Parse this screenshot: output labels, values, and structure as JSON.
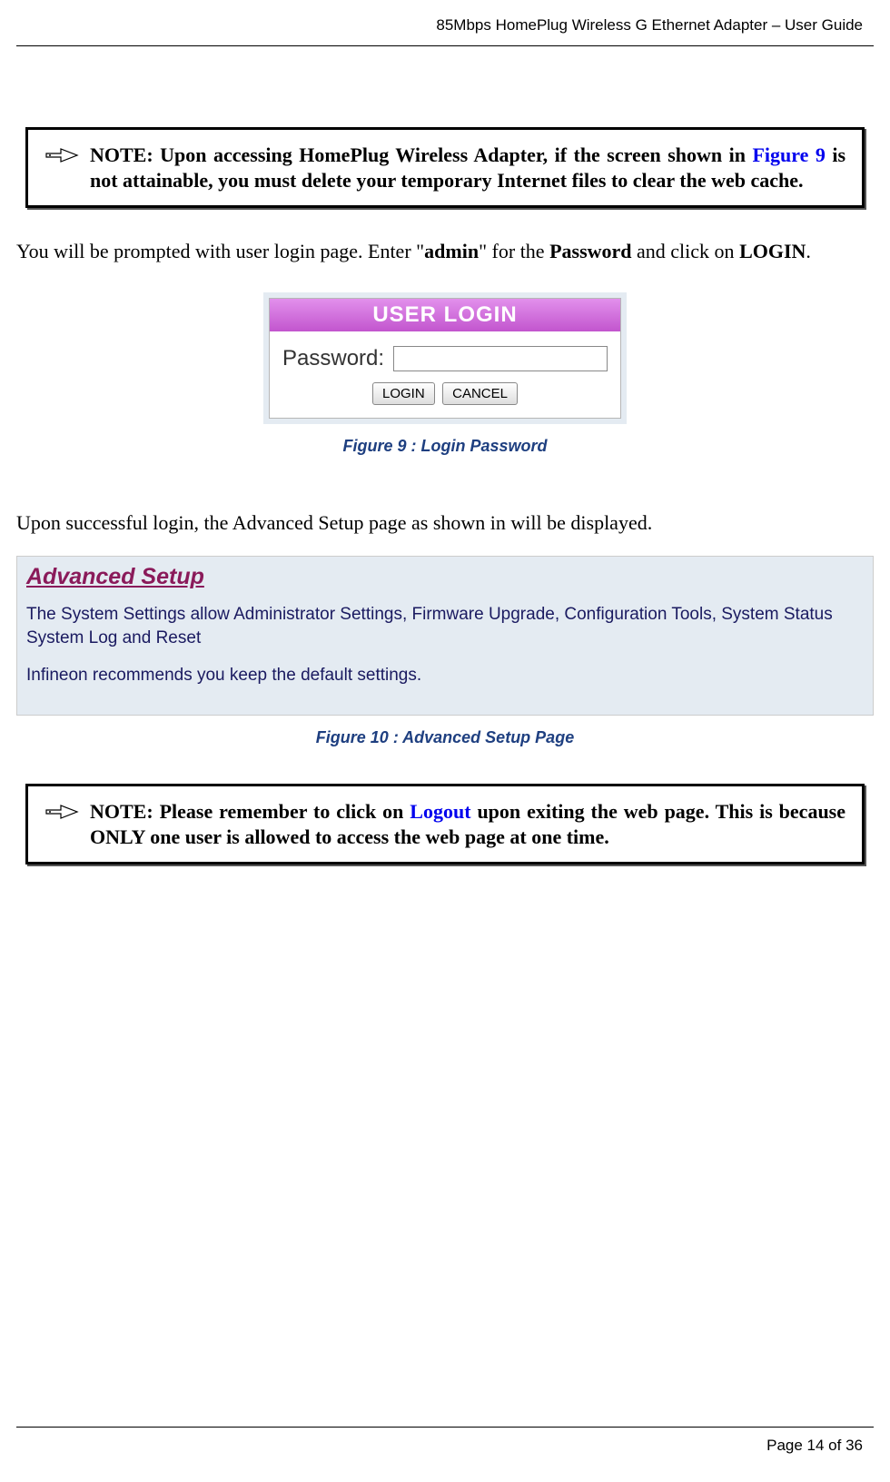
{
  "header": {
    "title": "85Mbps HomePlug Wireless G Ethernet Adapter – User Guide"
  },
  "note1": {
    "label": "NOTE:",
    "text_a": "Upon accessing HomePlug Wireless Adapter, if the screen shown in ",
    "figref": "Figure 9",
    "text_b": " is not attainable, you must delete your temporary Internet files to clear the web cache."
  },
  "para1": {
    "a": "You will be prompted with user login page. Enter \"",
    "admin": "admin",
    "b": "\" for the ",
    "pw": "Password",
    "c": " and click on ",
    "login": "LOGIN",
    "d": "."
  },
  "loginbox": {
    "title": "USER LOGIN",
    "label": "Password:",
    "btn_login": "LOGIN",
    "btn_cancel": "CANCEL"
  },
  "caption9": "Figure 9 : Login Password",
  "para2": "Upon successful login, the Advanced Setup page as shown in will be displayed.",
  "advsetup": {
    "title": "Advanced Setup",
    "p1": "The System Settings allow Administrator Settings, Firmware Upgrade, Configuration Tools, System Status System Log and Reset",
    "p2": "Infineon recommends you keep the default settings."
  },
  "caption10": "Figure 10 : Advanced Setup Page",
  "note2": {
    "label": "NOTE:",
    "a": " Please remember to click on ",
    "logout": "Logout",
    "b": " upon exiting the web page. This is because ONLY one user is allowed to access the web page at one time."
  },
  "footer": {
    "page": "Page 14 of 36"
  }
}
